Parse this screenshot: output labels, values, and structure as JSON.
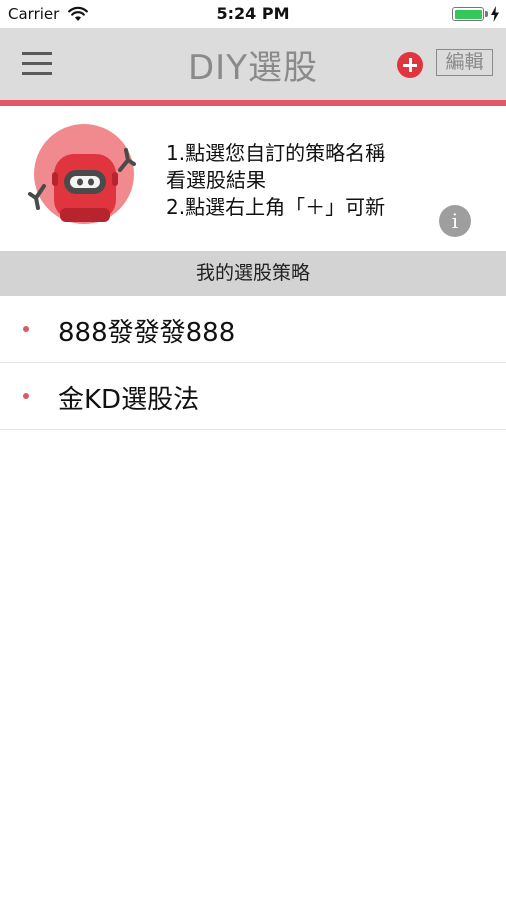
{
  "status_bar": {
    "carrier": "Carrier",
    "time": "5:24 PM",
    "battery_level": 1.0,
    "icons": [
      "wifi-icon",
      "battery-icon",
      "charging-bolt-icon"
    ]
  },
  "nav": {
    "title": "DIY選股",
    "edit_label": "編輯",
    "icons": [
      "menu-icon",
      "add-icon"
    ],
    "accent_color": "#e05766"
  },
  "intro": {
    "lines": [
      "1.點選您自訂的策略名稱",
      "看選股結果",
      "2.點選右上角「＋」可新"
    ],
    "info_label": "i",
    "mascot": "robot-mascot-icon"
  },
  "section": {
    "title": "我的選股策略"
  },
  "strategies": [
    {
      "label": "888發發發888"
    },
    {
      "label": "金KD選股法"
    }
  ],
  "colors": {
    "nav_background": "#dcdcdc",
    "section_background": "#d3d3d3",
    "add_button": "#e0343f",
    "bullet": "#e05766"
  }
}
